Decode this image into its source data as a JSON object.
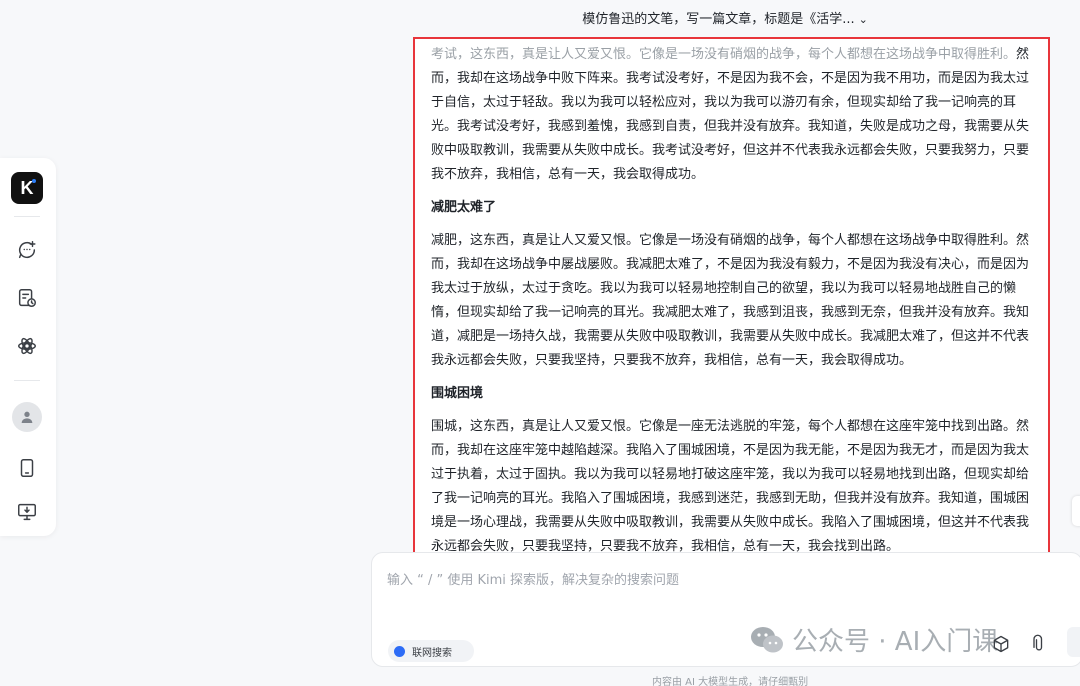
{
  "sidebar": {
    "logo_text": "K",
    "icons": [
      "new-chat-icon",
      "history-icon",
      "explore-icon",
      "user-avatar-icon",
      "mobile-app-icon",
      "desktop-download-icon"
    ]
  },
  "header": {
    "title": "模仿鲁迅的文笔，写一篇文章，标题是《活学..."
  },
  "article": {
    "intro_faded": "考试，这东西，真是让人又爱又恨。它像是一场没有硝烟的战争，每个人都想在这场战争中取得胜利。",
    "intro_rest": "然而，我却在这场战争中败下阵来。我考试没考好，不是因为我不会，不是因为我不用功，而是因为我太过于自信，太过于轻敌。我以为我可以轻松应对，我以为我可以游刃有余，但现实却给了我一记响亮的耳光。我考试没考好，我感到羞愧，我感到自责，但我并没有放弃。我知道，失败是成功之母，我需要从失败中吸取教训，我需要从失败中成长。我考试没考好，但这并不代表我永远都会失败，只要我努力，只要我不放弃，我相信，总有一天，我会取得成功。",
    "sections": [
      {
        "heading": "减肥太难了",
        "body": "减肥，这东西，真是让人又爱又恨。它像是一场没有硝烟的战争，每个人都想在这场战争中取得胜利。然而，我却在这场战争中屡战屡败。我减肥太难了，不是因为我没有毅力，不是因为我没有决心，而是因为我太过于放纵，太过于贪吃。我以为我可以轻易地控制自己的欲望，我以为我可以轻易地战胜自己的懒惰，但现实却给了我一记响亮的耳光。我减肥太难了，我感到沮丧，我感到无奈，但我并没有放弃。我知道，减肥是一场持久战，我需要从失败中吸取教训，我需要从失败中成长。我减肥太难了，但这并不代表我永远都会失败，只要我坚持，只要我不放弃，我相信，总有一天，我会取得成功。"
      },
      {
        "heading": "围城困境",
        "body": "围城，这东西，真是让人又爱又恨。它像是一座无法逃脱的牢笼，每个人都想在这座牢笼中找到出路。然而，我却在这座牢笼中越陷越深。我陷入了围城困境，不是因为我无能，不是因为我无才，而是因为我太过于执着，太过于固执。我以为我可以轻易地打破这座牢笼，我以为我可以轻易地找到出路，但现实却给了我一记响亮的耳光。我陷入了围城困境，我感到迷茫，我感到无助，但我并没有放弃。我知道，围城困境是一场心理战，我需要从失败中吸取教训，我需要从失败中成长。我陷入了围城困境，但这并不代表我永远都会失败，只要我坚持，只要我不放弃，我相信，总有一天，我会找到出路。"
      }
    ]
  },
  "composer": {
    "placeholder": "输入 “ / ” 使用 Kimi 探索版，解决复杂的搜索问题",
    "web_search_label": "联网搜索"
  },
  "watermark": {
    "text": "公众号 · AI入门课"
  },
  "footer": {
    "note": "内容由 AI 大模型生成，请仔细甄别"
  },
  "colors": {
    "highlight_border": "#e8353b",
    "toggle_on": "#2d6cf6"
  }
}
